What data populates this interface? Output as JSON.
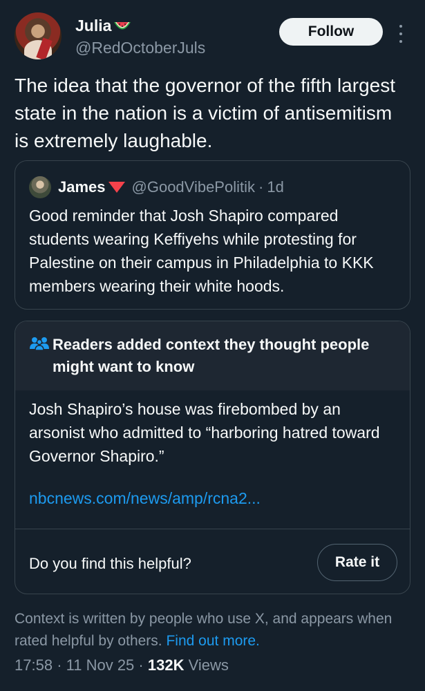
{
  "author": {
    "display_name": "Julia",
    "emoji": "watermelon-icon",
    "handle": "@RedOctoberJuls"
  },
  "follow_label": "Follow",
  "tweet_text": "The idea that the governor of the fifth largest state in the nation is a victim of antisemitism is extremely laughable.",
  "quote": {
    "display_name": "James",
    "emoji": "red-triangle-icon",
    "handle": "@GoodVibePolitik",
    "separator": "·",
    "time": "1d",
    "text": "Good reminder that Josh Shapiro compared students wearing Keffiyehs while protesting for Palestine on their campus in Philadelphia to KKK members wearing their white hoods."
  },
  "community_note": {
    "title": "Readers added context they thought people might want to know",
    "body": "Josh Shapiro’s house was firebombed by an arsonist who admitted to “harboring hatred toward Governor Shapiro.”",
    "link": "nbcnews.com/news/amp/rcna2...",
    "question": "Do you find this helpful?",
    "rate_label": "Rate it"
  },
  "footer": {
    "text": "Context is written by people who use X, and appears when rated helpful by others.",
    "find_more": "Find out more."
  },
  "meta": {
    "time": "17:58",
    "sep1": "·",
    "date": "11 Nov 25",
    "sep2": "·",
    "views_count": "132K",
    "views_label": "Views"
  },
  "colors": {
    "background": "#15202b",
    "link": "#1d9bf0",
    "muted": "#8b98a5",
    "border": "#38444d"
  }
}
